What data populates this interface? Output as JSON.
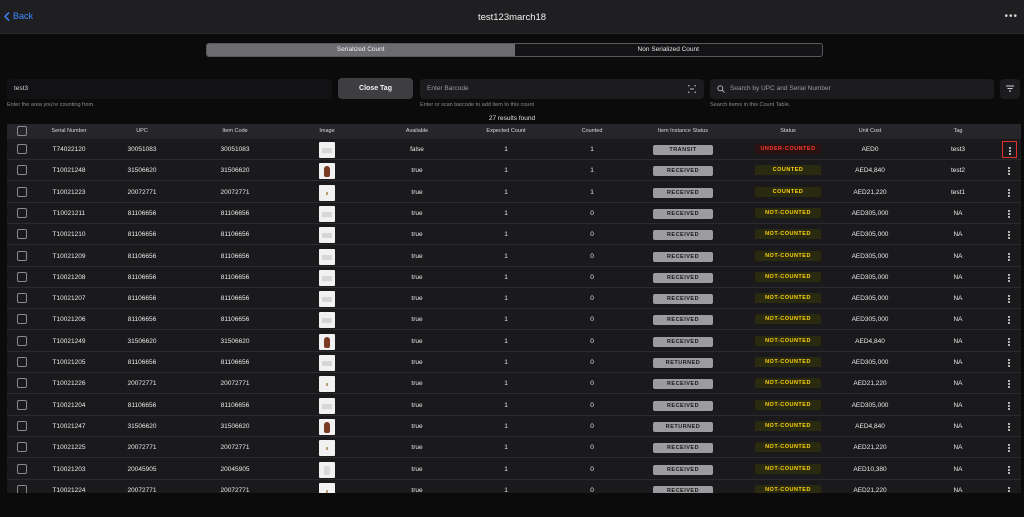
{
  "header": {
    "back_label": "Back",
    "title": "test123march18"
  },
  "segments": [
    {
      "label": "Serialized Count"
    },
    {
      "label": "Non Serialized Count"
    }
  ],
  "area_field": {
    "value": "test3",
    "hint": "Enter the area you're counting from."
  },
  "close_tag_label": "Close Tag",
  "barcode_field": {
    "placeholder": "Enter Barcode",
    "hint": "Enter or scan barcode to add item to this count"
  },
  "search_field": {
    "placeholder": "Search by UPC and Serial Number",
    "hint": "Search items in this Count Table."
  },
  "results_text": "27 results found",
  "colors": {
    "transit": "#9c9ca0",
    "received": "#9c9ca0",
    "returned": "#9c9ca0",
    "under_counted": "#ff3b30",
    "counted": "#ffd60a",
    "not_counted": "#ffd60a",
    "highlight": "#e0302a",
    "back": "#3d8bff"
  },
  "columns": [
    "Serial Number",
    "UPC",
    "Item Code",
    "Image",
    "Available",
    "Expected Count",
    "Counted",
    "Item Instance Status",
    "Status",
    "Unit Cost",
    "Tag"
  ],
  "rows": [
    {
      "serial": "T74022120",
      "upc": "30051083",
      "item_code": "30051083",
      "image": "box",
      "available": "false",
      "expected": "1",
      "counted": "1",
      "instance_status": "TRANSIT",
      "status": "UNDER-COUNTED",
      "status_kind": "under",
      "unit_cost": "AED0",
      "tag": "test3"
    },
    {
      "serial": "T10021248",
      "upc": "31506620",
      "item_code": "31506620",
      "image": "vase",
      "available": "true",
      "expected": "1",
      "counted": "1",
      "instance_status": "RECEIVED",
      "status": "COUNTED",
      "status_kind": "counted",
      "unit_cost": "AED4,840",
      "tag": "test2"
    },
    {
      "serial": "T10021223",
      "upc": "20072771",
      "item_code": "20072771",
      "image": "small",
      "available": "true",
      "expected": "1",
      "counted": "1",
      "instance_status": "RECEIVED",
      "status": "COUNTED",
      "status_kind": "counted",
      "unit_cost": "AED21,220",
      "tag": "test1"
    },
    {
      "serial": "T10021211",
      "upc": "81106656",
      "item_code": "81106656",
      "image": "box",
      "available": "true",
      "expected": "1",
      "counted": "0",
      "instance_status": "RECEIVED",
      "status": "NOT-COUNTED",
      "status_kind": "not",
      "unit_cost": "AED305,000",
      "tag": "NA"
    },
    {
      "serial": "T10021210",
      "upc": "81106656",
      "item_code": "81106656",
      "image": "box",
      "available": "true",
      "expected": "1",
      "counted": "0",
      "instance_status": "RECEIVED",
      "status": "NOT-COUNTED",
      "status_kind": "not",
      "unit_cost": "AED305,000",
      "tag": "NA"
    },
    {
      "serial": "T10021209",
      "upc": "81106656",
      "item_code": "81106656",
      "image": "box",
      "available": "true",
      "expected": "1",
      "counted": "0",
      "instance_status": "RECEIVED",
      "status": "NOT-COUNTED",
      "status_kind": "not",
      "unit_cost": "AED305,000",
      "tag": "NA"
    },
    {
      "serial": "T10021208",
      "upc": "81106656",
      "item_code": "81106656",
      "image": "box",
      "available": "true",
      "expected": "1",
      "counted": "0",
      "instance_status": "RECEIVED",
      "status": "NOT-COUNTED",
      "status_kind": "not",
      "unit_cost": "AED305,000",
      "tag": "NA"
    },
    {
      "serial": "T10021207",
      "upc": "81106656",
      "item_code": "81106656",
      "image": "box",
      "available": "true",
      "expected": "1",
      "counted": "0",
      "instance_status": "RECEIVED",
      "status": "NOT-COUNTED",
      "status_kind": "not",
      "unit_cost": "AED305,000",
      "tag": "NA"
    },
    {
      "serial": "T10021206",
      "upc": "81106656",
      "item_code": "81106656",
      "image": "box",
      "available": "true",
      "expected": "1",
      "counted": "0",
      "instance_status": "RECEIVED",
      "status": "NOT-COUNTED",
      "status_kind": "not",
      "unit_cost": "AED305,000",
      "tag": "NA"
    },
    {
      "serial": "T10021249",
      "upc": "31506620",
      "item_code": "31506620",
      "image": "vase",
      "available": "true",
      "expected": "1",
      "counted": "0",
      "instance_status": "RECEIVED",
      "status": "NOT-COUNTED",
      "status_kind": "not",
      "unit_cost": "AED4,840",
      "tag": "NA"
    },
    {
      "serial": "T10021205",
      "upc": "81106656",
      "item_code": "81106656",
      "image": "box",
      "available": "true",
      "expected": "1",
      "counted": "0",
      "instance_status": "RETURNED",
      "status": "NOT-COUNTED",
      "status_kind": "not",
      "unit_cost": "AED305,000",
      "tag": "NA"
    },
    {
      "serial": "T10021226",
      "upc": "20072771",
      "item_code": "20072771",
      "image": "small",
      "available": "true",
      "expected": "1",
      "counted": "0",
      "instance_status": "RECEIVED",
      "status": "NOT-COUNTED",
      "status_kind": "not",
      "unit_cost": "AED21,220",
      "tag": "NA"
    },
    {
      "serial": "T10021204",
      "upc": "81106656",
      "item_code": "81106656",
      "image": "box",
      "available": "true",
      "expected": "1",
      "counted": "0",
      "instance_status": "RECEIVED",
      "status": "NOT-COUNTED",
      "status_kind": "not",
      "unit_cost": "AED305,000",
      "tag": "NA"
    },
    {
      "serial": "T10021247",
      "upc": "31506620",
      "item_code": "31506620",
      "image": "vase",
      "available": "true",
      "expected": "1",
      "counted": "0",
      "instance_status": "RETURNED",
      "status": "NOT-COUNTED",
      "status_kind": "not",
      "unit_cost": "AED4,840",
      "tag": "NA"
    },
    {
      "serial": "T10021225",
      "upc": "20072771",
      "item_code": "20072771",
      "image": "small",
      "available": "true",
      "expected": "1",
      "counted": "0",
      "instance_status": "RECEIVED",
      "status": "NOT-COUNTED",
      "status_kind": "not",
      "unit_cost": "AED21,220",
      "tag": "NA"
    },
    {
      "serial": "T10021203",
      "upc": "20045905",
      "item_code": "20045905",
      "image": "jar",
      "available": "true",
      "expected": "1",
      "counted": "0",
      "instance_status": "RECEIVED",
      "status": "NOT-COUNTED",
      "status_kind": "not",
      "unit_cost": "AED10,380",
      "tag": "NA"
    },
    {
      "serial": "T10021224",
      "upc": "20072771",
      "item_code": "20072771",
      "image": "small",
      "available": "true",
      "expected": "1",
      "counted": "0",
      "instance_status": "RECEIVED",
      "status": "NOT-COUNTED",
      "status_kind": "not",
      "unit_cost": "AED21,220",
      "tag": "NA"
    }
  ]
}
